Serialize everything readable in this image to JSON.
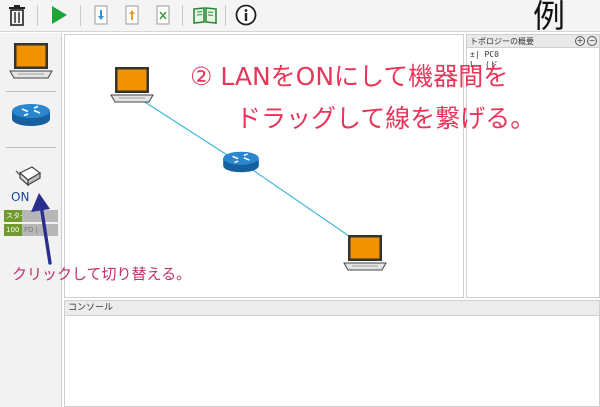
{
  "toolbar": {
    "icons": [
      "trash-icon",
      "play-icon",
      "import-icon",
      "export-icon",
      "clear-icon",
      "book-icon",
      "info-icon"
    ],
    "example_mark": "例"
  },
  "palette": {
    "items": [
      "laptop-icon",
      "router-icon",
      "switch-toggle-icon"
    ],
    "on_label": "ON",
    "stats": [
      {
        "key": "スター",
        "value": ""
      },
      {
        "key": "100",
        "value": "FD | "
      }
    ]
  },
  "topology": {
    "title": "トポロジーの概要",
    "items": [
      "±| PC0",
      "L‥ (ド"
    ]
  },
  "console": {
    "title": "コンソール"
  },
  "annotations": {
    "instruction_line1": "② LANをONにして機器間を",
    "instruction_line2": "ドラッグして線を繋げる。",
    "hint": "クリックして切り替える。"
  },
  "colors": {
    "annotation_red": "#e8355a",
    "hint_magenta": "#c0306a",
    "arrow_navy": "#2a2f8f",
    "laptop_screen": "#f39200",
    "router_blue": "#1f6fb2",
    "link_cyan": "#3fb6d8"
  }
}
